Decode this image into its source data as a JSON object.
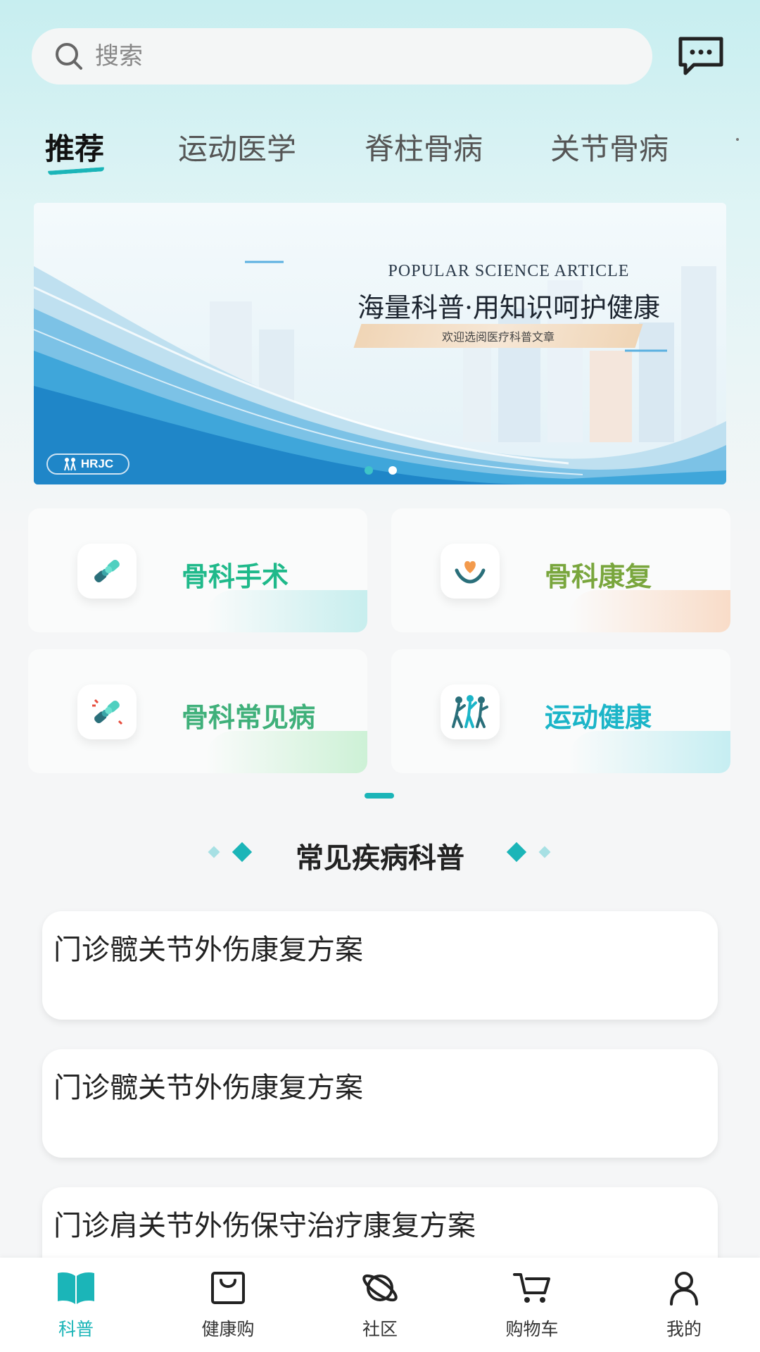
{
  "search": {
    "placeholder": "搜索"
  },
  "tabs": [
    {
      "label": "推荐",
      "active": true
    },
    {
      "label": "运动医学"
    },
    {
      "label": "脊柱骨病"
    },
    {
      "label": "关节骨病"
    }
  ],
  "banner": {
    "subtitle": "POPULAR SCIENCE ARTICLE",
    "title": "海量科普·用知识呵护健康",
    "tag": "欢迎选阅医疗科普文章",
    "logo": "HRJC",
    "slide_count": 2,
    "active_slide": 1
  },
  "categories": [
    {
      "label": "骨科手术",
      "color": "#1fb98a",
      "icon": "bone-joint-icon"
    },
    {
      "label": "骨科康复",
      "color": "#79a63d",
      "icon": "heart-hands-icon"
    },
    {
      "label": "骨科常见病",
      "color": "#3fb07a",
      "icon": "joint-pain-icon"
    },
    {
      "label": "运动健康",
      "color": "#1bb5c8",
      "icon": "sports-people-icon"
    }
  ],
  "section": {
    "title": "常见疾病科普"
  },
  "articles": [
    {
      "title": "门诊髋关节外伤康复方案"
    },
    {
      "title": "门诊髋关节外伤康复方案"
    },
    {
      "title": "门诊肩关节外伤保守治疗康复方案"
    }
  ],
  "nav": [
    {
      "label": "科普",
      "icon": "book-icon",
      "active": true
    },
    {
      "label": "健康购",
      "icon": "shopping-bag-icon"
    },
    {
      "label": "社区",
      "icon": "planet-icon"
    },
    {
      "label": "购物车",
      "icon": "cart-icon"
    },
    {
      "label": "我的",
      "icon": "person-icon"
    }
  ],
  "colors": {
    "accent": "#1bb5b8"
  }
}
